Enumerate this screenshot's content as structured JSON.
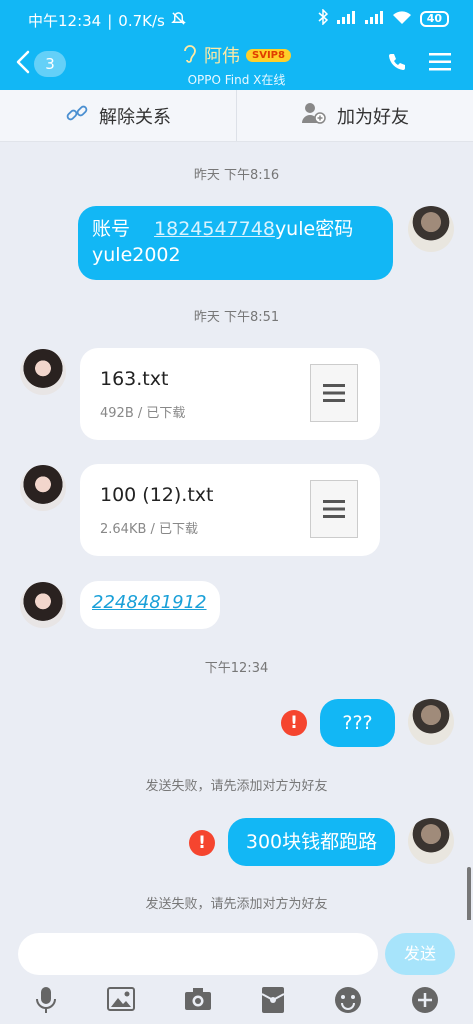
{
  "status_bar": {
    "time": "中午12:34",
    "speed": "0.7K/s",
    "battery": "40"
  },
  "header": {
    "back_count": "3",
    "contact_name": "阿伟",
    "vip_badge": "SVIP8",
    "device": "OPPO Find X在线"
  },
  "actions": {
    "unlink": "解除关系",
    "add_friend": "加为好友"
  },
  "messages": {
    "ts1": "昨天 下午8:16",
    "msg1_prefix": "账号 ",
    "msg1_link": "1824547748",
    "msg1_suffix": "yule密码",
    "msg1_line2": "yule2002",
    "ts2": "昨天 下午8:51",
    "file1_name": "163.txt",
    "file1_meta": "492B / 已下载",
    "file2_name": "100 (12).txt",
    "file2_meta": "2.64KB / 已下载",
    "link_msg": "2248481912",
    "ts3": "下午12:34",
    "msg_q": "???",
    "fail1": "发送失败，请先添加对方为好友",
    "msg_300": "300块钱都跑路",
    "fail2": "发送失败，请先添加对方为好友",
    "error_mark": "!"
  },
  "input": {
    "placeholder": "",
    "send_label": "发送"
  },
  "icons": [
    "mic-icon",
    "image-icon",
    "camera-icon",
    "red-packet-icon",
    "emoji-icon",
    "plus-icon"
  ],
  "colors": {
    "brand": "#12b7f5",
    "error": "#f5452f",
    "background": "#eaedf4"
  }
}
